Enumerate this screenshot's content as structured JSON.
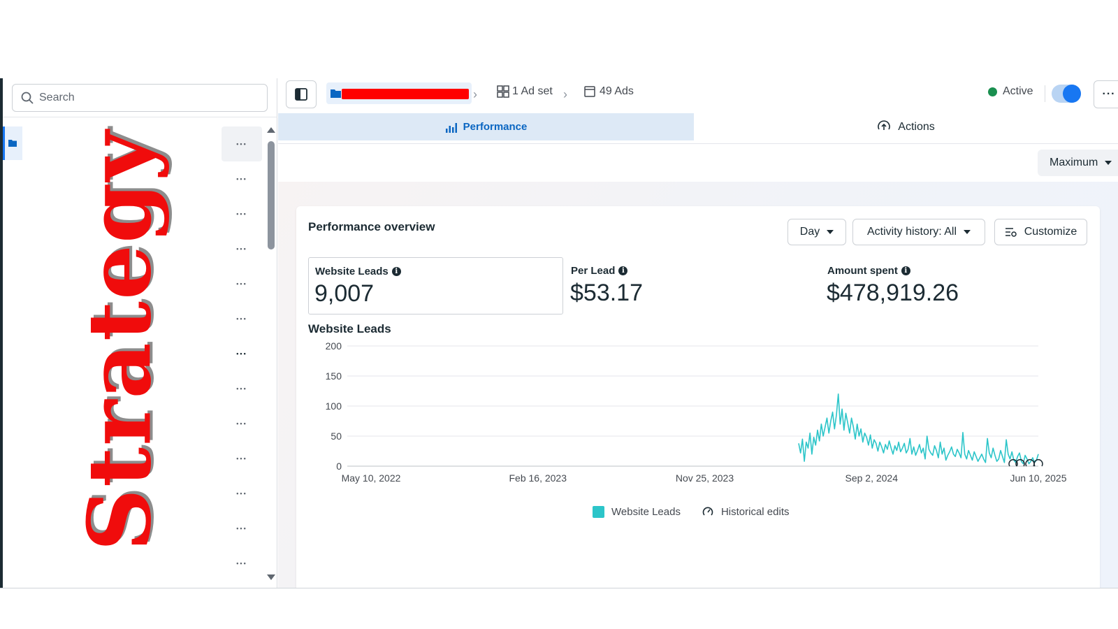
{
  "sidebar": {
    "search_placeholder": "Search",
    "row_count": 13,
    "overlay_text": "Strategy"
  },
  "header": {
    "adset_label": "1 Ad set",
    "ads_label": "49 Ads",
    "status_label": "Active",
    "toggle_on": true
  },
  "tabs": {
    "performance": "Performance",
    "actions": "Actions"
  },
  "date_preset": "Maximum",
  "overview": {
    "title": "Performance overview",
    "day_button": "Day",
    "activity_button": "Activity history: All",
    "customize_button": "Customize",
    "metrics": [
      {
        "label": "Website Leads",
        "value": "9,007"
      },
      {
        "label": "Per Lead",
        "value": "$53.17"
      },
      {
        "label": "Amount spent",
        "value": "$478,919.26"
      }
    ]
  },
  "chart_data": {
    "type": "line",
    "title": "Website Leads",
    "xlabel": "",
    "ylabel": "",
    "ylim": [
      0,
      200
    ],
    "yticks": [
      0,
      50,
      100,
      150,
      200
    ],
    "xticks": [
      "May 10, 2022",
      "Feb 16, 2023",
      "Nov 25, 2023",
      "Sep 2, 2024",
      "Jun 10, 2025"
    ],
    "grid": true,
    "legend_placement": "bottom-center",
    "series": [
      {
        "name": "Website Leads",
        "color": "#2cc5c9",
        "x_range": [
          "Apr 20, 2024",
          "Jun 10, 2025"
        ],
        "values": [
          38,
          22,
          45,
          8,
          40,
          30,
          55,
          20,
          48,
          35,
          60,
          42,
          70,
          50,
          65,
          80,
          55,
          75,
          90,
          62,
          85,
          120,
          70,
          95,
          60,
          88,
          72,
          55,
          80,
          65,
          45,
          70,
          50,
          62,
          40,
          55,
          48,
          35,
          52,
          30,
          44,
          38,
          25,
          40,
          32,
          22,
          36,
          28,
          42,
          30,
          20,
          34,
          26,
          40,
          24,
          30,
          38,
          22,
          28,
          46,
          20,
          32,
          18,
          26,
          36,
          22,
          30,
          12,
          50,
          28,
          22,
          18,
          34,
          26,
          14,
          40,
          20,
          30,
          10,
          18,
          24,
          32,
          20,
          16,
          28,
          22,
          14,
          56,
          20,
          12,
          26,
          18,
          10,
          24,
          16,
          8,
          14,
          20,
          12,
          6,
          46,
          22,
          14,
          30,
          18,
          8,
          12,
          26,
          16,
          6,
          44,
          20,
          12,
          24,
          10,
          6,
          16,
          22,
          8,
          4,
          18,
          12,
          4,
          8,
          14,
          6,
          10,
          20
        ]
      }
    ],
    "legend": [
      "Website Leads",
      "Historical edits"
    ]
  },
  "colors": {
    "accent": "#1877f2",
    "line": "#2cc5c9",
    "active_status": "#1a8f4f",
    "overlay_red": "#f00c0c"
  }
}
